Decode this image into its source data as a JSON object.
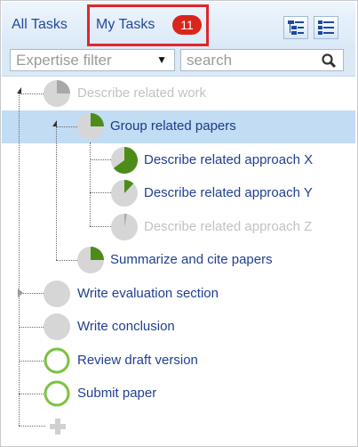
{
  "tabs": {
    "all_tasks": "All Tasks",
    "my_tasks": "My Tasks",
    "my_tasks_count": "11"
  },
  "filters": {
    "expertise_placeholder": "Expertise filter",
    "search_placeholder": "search"
  },
  "tasks": [
    {
      "label": "Describe related work",
      "progress": 0.25,
      "state": "disabled",
      "expanded": true
    },
    {
      "label": "Group related papers",
      "progress": 0.25,
      "state": "selected",
      "expanded": true
    },
    {
      "label": "Describe related approach X",
      "progress": 0.65,
      "state": "active"
    },
    {
      "label": "Describe related approach Y",
      "progress": 0.12,
      "state": "active"
    },
    {
      "label": "Describe related approach Z",
      "progress": 0.03,
      "state": "disabled"
    },
    {
      "label": "Summarize and cite papers",
      "progress": 0.25,
      "state": "active"
    },
    {
      "label": "Write evaluation section",
      "progress": 0,
      "state": "collapsed"
    },
    {
      "label": "Write conclusion",
      "progress": 0,
      "state": "active"
    },
    {
      "label": "Review draft version",
      "progress": 0,
      "state": "ring"
    },
    {
      "label": "Submit paper",
      "progress": 0,
      "state": "ring"
    }
  ],
  "colors": {
    "progress_green": "#4e8c19",
    "ring_green": "#7cc242",
    "selection": "#c2dcf4",
    "badge_red": "#d9261c",
    "highlight_red": "#e0262a",
    "pie_background": "#d6d6d6",
    "pie_disabled_fill": "#a8a8a8"
  },
  "icons": {
    "tree_view": "tree-view-icon",
    "list_view": "list-view-icon",
    "search": "search-icon",
    "add_task": "plus-icon"
  }
}
